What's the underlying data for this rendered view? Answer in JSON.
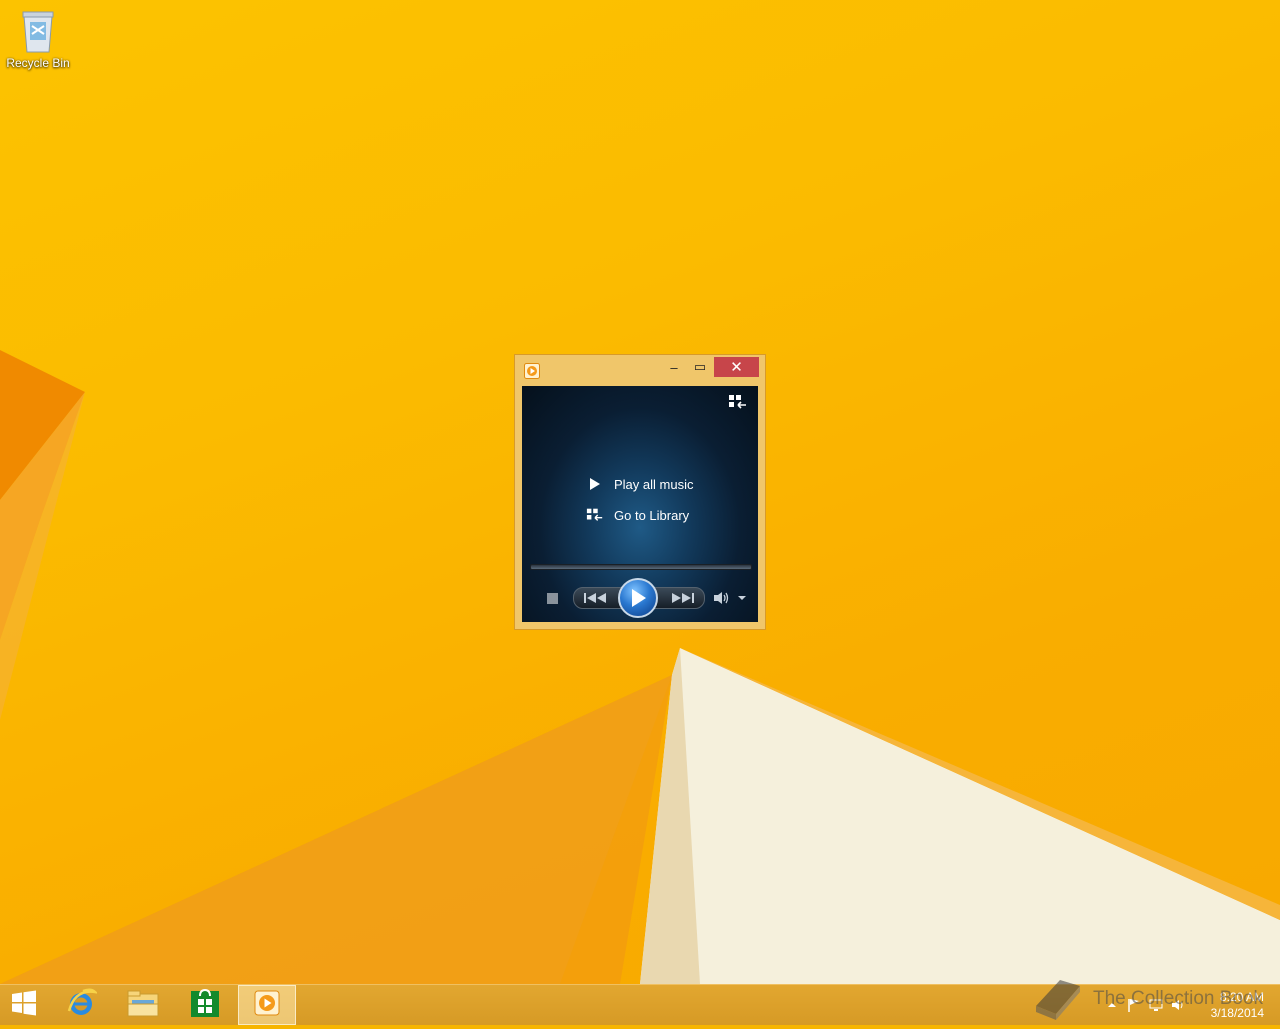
{
  "desktop": {
    "icons": [
      {
        "label": "Recycle Bin",
        "icon": "recycle-bin-icon"
      }
    ]
  },
  "window": {
    "app_icon": "windows-media-player-icon",
    "controls": {
      "minimize": "–",
      "maximize": "▭",
      "close": "✕"
    },
    "player": {
      "links": [
        {
          "label": "Play all music",
          "icon": "play-icon"
        },
        {
          "label": "Go to Library",
          "icon": "switch-to-library-icon"
        }
      ],
      "seek_position": 0,
      "controls": [
        "stop",
        "previous",
        "play",
        "next",
        "volume",
        "volume-dropdown"
      ]
    }
  },
  "taskbar": {
    "items": [
      {
        "name": "start",
        "icon": "windows-logo-icon"
      },
      {
        "name": "internet-explorer",
        "icon": "ie-icon"
      },
      {
        "name": "file-explorer",
        "icon": "folder-icon"
      },
      {
        "name": "store",
        "icon": "store-icon"
      },
      {
        "name": "windows-media-player",
        "icon": "windows-media-player-icon",
        "active": true
      }
    ],
    "tray": {
      "time": "8:20 AM",
      "date": "3/18/2014"
    }
  },
  "watermark": {
    "text": "The Collection Book"
  },
  "colors": {
    "wallpaper": "#fbbb00",
    "window_frame": "#f0c66a",
    "close_button": "#c7454a",
    "taskbar": "#d69a25"
  }
}
